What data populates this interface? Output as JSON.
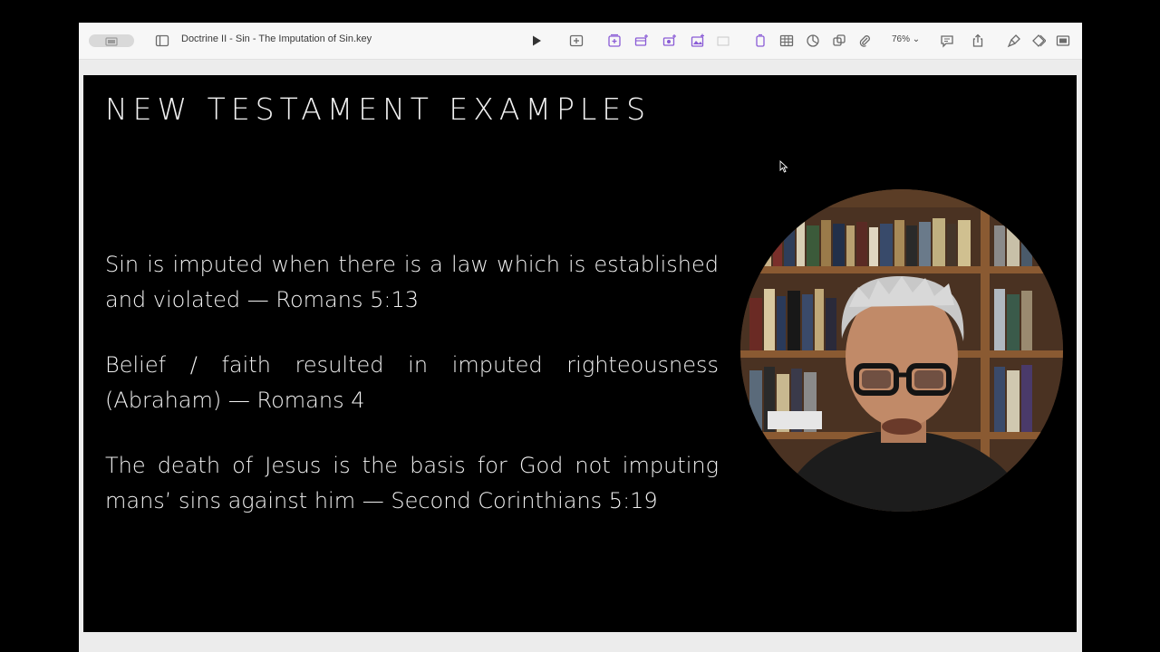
{
  "window": {
    "document_title": "Doctrine II - Sin - The Imputation of Sin.key",
    "zoom_level": "76%"
  },
  "toolbar": {
    "icons": [
      "view-icon",
      "sidebar-icon",
      "play-icon",
      "add-slide-icon",
      "table-icon",
      "chart-icon",
      "text-icon",
      "shape-icon",
      "media-icon",
      "comment-icon",
      "share-icon",
      "format-icon",
      "animate-icon",
      "document-icon"
    ]
  },
  "slide": {
    "title": "NEW TESTAMENT EXAMPLES",
    "bullets": [
      "Sin is imputed when there is a law which is established and violated — Romans 5:13",
      "Belief / faith resulted in imputed righteousness (Abraham) — Romans 4",
      "The death of Jesus is the basis for God not imputing mans’ sins against him — Second Corinthians 5:19"
    ]
  },
  "colors": {
    "slide_background": "#000000",
    "slide_text": "#f2f2f2",
    "toolbar_accent": "#8a5bd6"
  }
}
